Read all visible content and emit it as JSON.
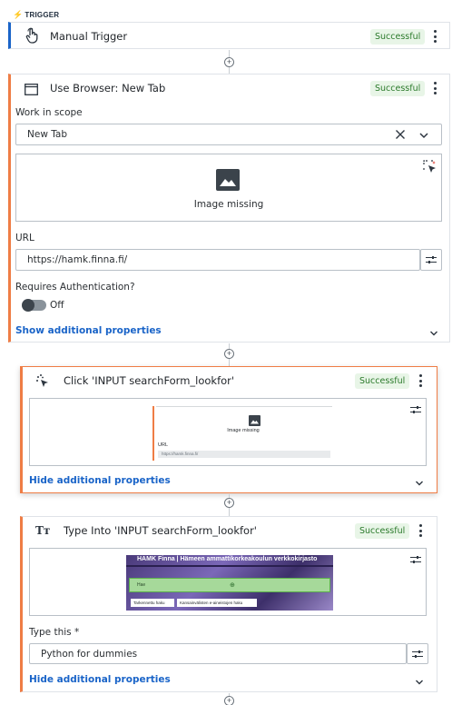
{
  "trigger": {
    "section_label": "TRIGGER",
    "title": "Manual Trigger",
    "status": "Successful"
  },
  "browser_step": {
    "title": "Use Browser: New Tab",
    "status": "Successful",
    "work_in_scope_label": "Work in scope",
    "work_in_scope_value": "New Tab",
    "image_missing_text": "Image missing",
    "url_label": "URL",
    "url_value": "https://hamk.finna.fi/",
    "auth_label": "Requires Authentication?",
    "auth_toggle_text": "Off",
    "show_more_link": "Show additional properties"
  },
  "click_step": {
    "title": "Click 'INPUT searchForm_lookfor'",
    "status": "Successful",
    "preview_image_missing": "Image missing",
    "preview_url_label": "URL",
    "preview_url_value": "https://hamk.finna.fi/",
    "hide_link": "Hide additional properties",
    "accent_color": "#ef7d45"
  },
  "type_step": {
    "title": "Type Into 'INPUT searchForm_lookfor'",
    "status": "Successful",
    "preview_header": "HAMK Finna | Hämeen ammattikorkeakoulun verkkokirjasto",
    "preview_search_placeholder": "Hae",
    "preview_btn1": "Tarkennettu haku",
    "preview_btn2": "Kansainvälisten e-aineistojen haku",
    "type_this_label": "Type this *",
    "type_this_value": "Python for dummies",
    "hide_link": "Hide additional properties"
  },
  "colors": {
    "accent_blue": "#1a64c8",
    "accent_orange": "#ef7d45",
    "success_bg": "#e8f5e7",
    "success_fg": "#2b7a2b"
  }
}
